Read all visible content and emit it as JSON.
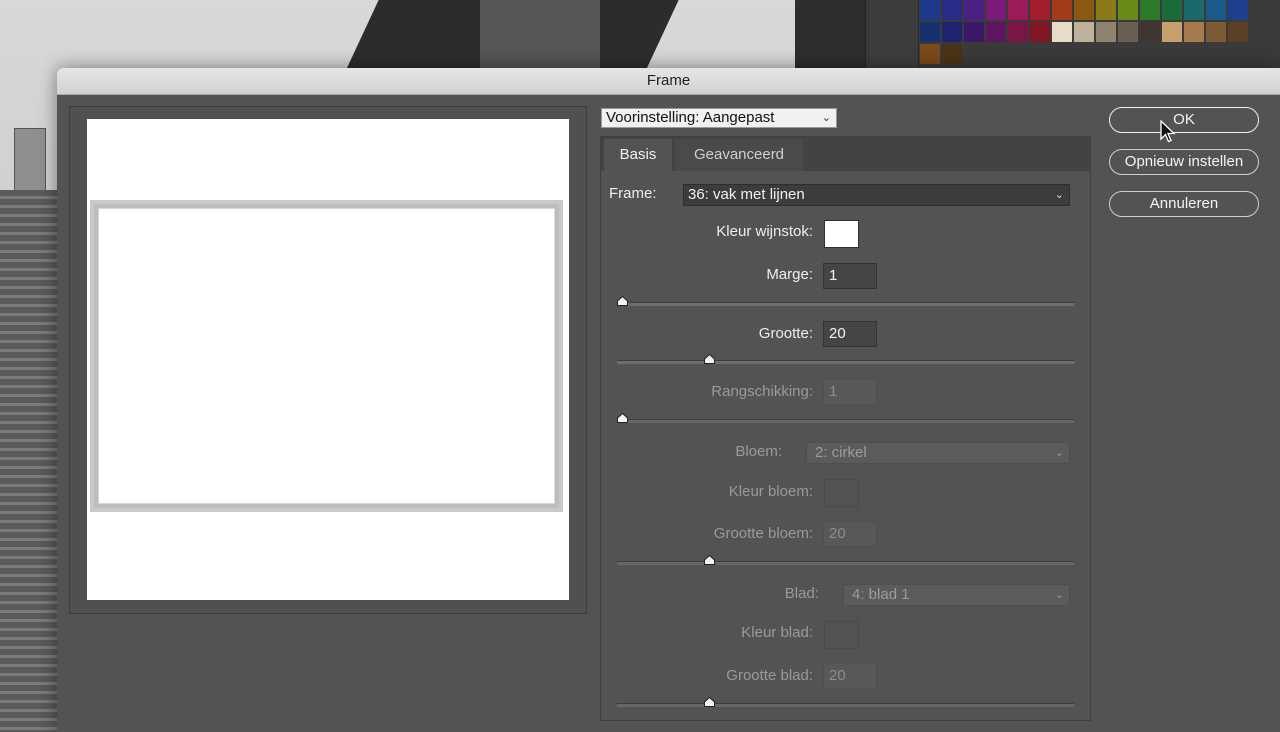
{
  "dialog": {
    "title": "Frame"
  },
  "preset": {
    "label": "Voorinstelling: Aangepast"
  },
  "tabs": [
    {
      "label": "Basis"
    },
    {
      "label": "Geavanceerd"
    }
  ],
  "frame": {
    "label": "Frame:",
    "value": "36: vak met lijnen"
  },
  "kleur_wijnstok": {
    "label": "Kleur wijnstok:",
    "color": "#ffffff"
  },
  "marge": {
    "label": "Marge:",
    "value": "1",
    "slider_fraction": 0.0
  },
  "grootte": {
    "label": "Grootte:",
    "value": "20",
    "slider_fraction": 0.19
  },
  "rangschikking": {
    "label": "Rangschikking:",
    "value": "1",
    "slider_fraction": 0.0
  },
  "bloem": {
    "label": "Bloem:",
    "value": "2: cirkel"
  },
  "kleur_bloem": {
    "label": "Kleur bloem:",
    "color": "#535353"
  },
  "grootte_bloem": {
    "label": "Grootte bloem:",
    "value": "20",
    "slider_fraction": 0.19
  },
  "blad": {
    "label": "Blad:",
    "value": "4: blad 1"
  },
  "kleur_blad": {
    "label": "Kleur blad:",
    "color": "#535353"
  },
  "grootte_blad": {
    "label": "Grootte blad:",
    "value": "20",
    "slider_fraction": 0.19
  },
  "buttons": {
    "ok": "OK",
    "reset": "Opnieuw instellen",
    "cancel": "Annuleren"
  },
  "swatch_colors": [
    "#1d3a8a",
    "#2a2a8a",
    "#4a1f86",
    "#7a1a7a",
    "#9b1a5a",
    "#a31c2c",
    "#a33a1a",
    "#8a5a14",
    "#8a7a1a",
    "#6a8a1a",
    "#2f7a2a",
    "#1a6a3a",
    "#1a6a6a",
    "#1a5a8a",
    "#1f3f8f",
    "#163070",
    "#1f2270",
    "#3a186a",
    "#5e1560",
    "#7a1546",
    "#801524",
    "#e8dcc8",
    "#bfb19a",
    "#8f8270",
    "#6a5e52",
    "#403630",
    "#c8a070",
    "#a67c4e",
    "#7c5a34",
    "#5c4024",
    "#7a4a1a",
    "#4a3418"
  ]
}
